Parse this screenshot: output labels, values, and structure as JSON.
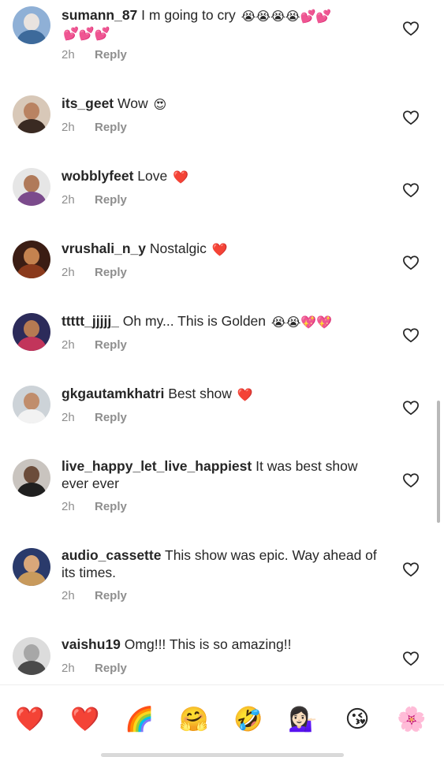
{
  "comments": [
    {
      "username": "sumann_87",
      "text": "I m going to cry",
      "emojis": "😭😭😭😭💕💕",
      "emojis2": "💕💕💕",
      "time": "2h",
      "reply": "Reply"
    },
    {
      "username": "its_geet",
      "text": "Wow",
      "emojis": "😍",
      "time": "2h",
      "reply": "Reply"
    },
    {
      "username": "wobblyfeet",
      "text": "Love",
      "emojis": "❤️",
      "time": "2h",
      "reply": "Reply"
    },
    {
      "username": "vrushali_n_y",
      "text": "Nostalgic",
      "emojis": "❤️",
      "time": "2h",
      "reply": "Reply"
    },
    {
      "username": "ttttt_jjjjj_",
      "text": "Oh my... This is Golden",
      "emojis": "😭😭💖💖",
      "time": "2h",
      "reply": "Reply"
    },
    {
      "username": "gkgautamkhatri",
      "text": "Best show",
      "emojis": "❤️",
      "time": "2h",
      "reply": "Reply"
    },
    {
      "username": "live_happy_let_live_happiest",
      "text": "It was best show ever ever",
      "emojis": "",
      "time": "2h",
      "reply": "Reply"
    },
    {
      "username": "audio_cassette",
      "text": "This show was epic. Way ahead of its times.",
      "emojis": "",
      "time": "2h",
      "reply": "Reply"
    },
    {
      "username": "vaishu19",
      "text": "Omg!!! This is so amazing!!",
      "emojis": "",
      "time": "2h",
      "reply": "Reply"
    }
  ],
  "emoji_bar": [
    "❤️",
    "❤️",
    "🌈",
    "🤗",
    "🤣",
    "💁🏻‍♀️",
    "😘",
    "🌸"
  ],
  "colors": {
    "text": "#262626",
    "meta": "#8e8e8e",
    "heart_outline": "#262626"
  },
  "icons": {
    "like": "heart-outline-icon"
  }
}
